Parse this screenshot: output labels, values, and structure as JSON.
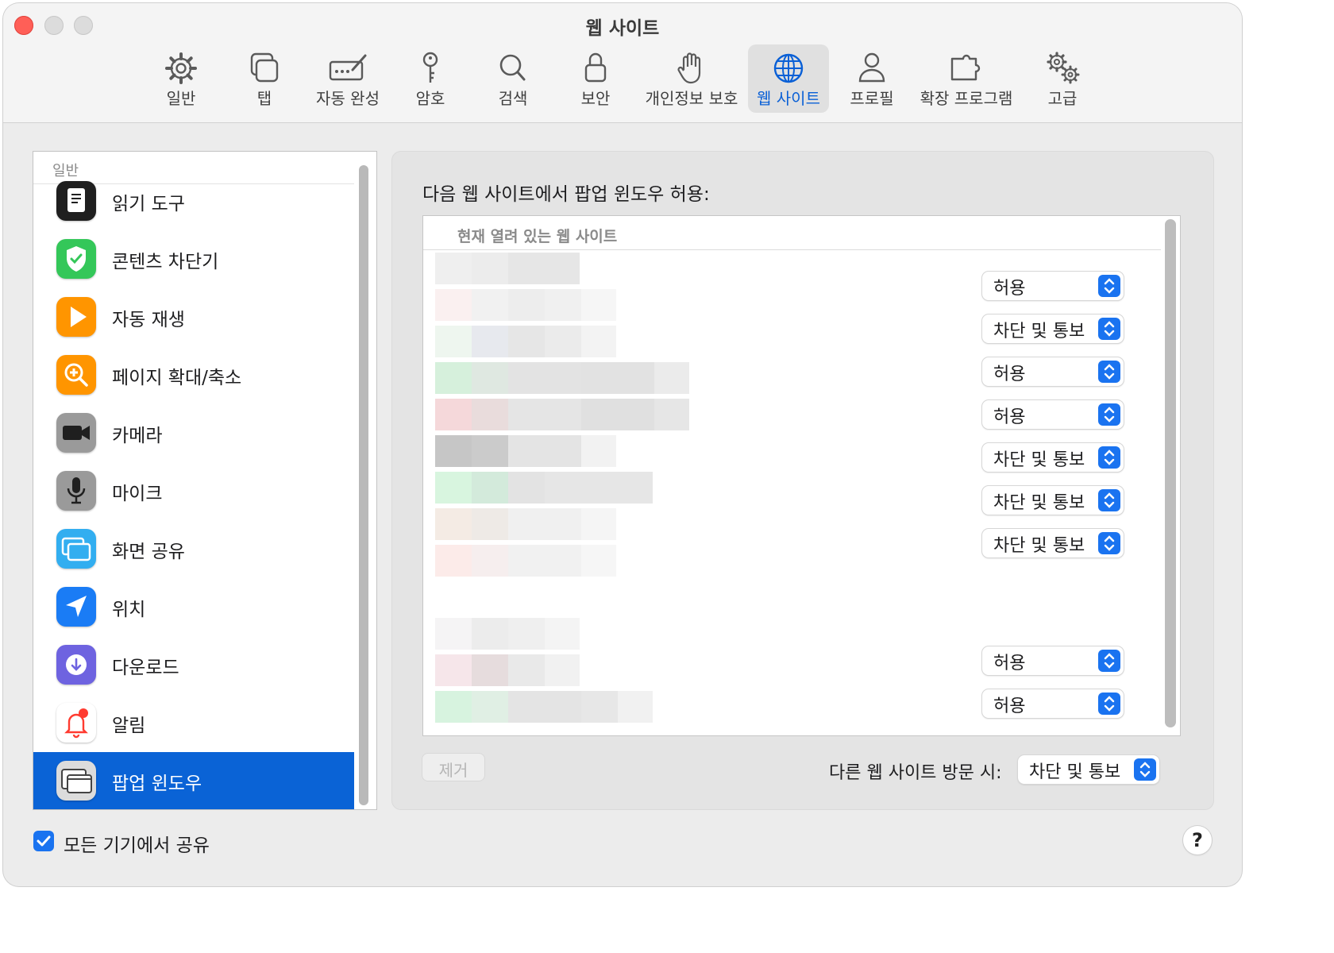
{
  "window": {
    "title": "웹 사이트"
  },
  "toolbar": {
    "items": [
      {
        "label": "일반",
        "icon": "gear-icon"
      },
      {
        "label": "탭",
        "icon": "tabs-icon"
      },
      {
        "label": "자동 완성",
        "icon": "autofill-icon"
      },
      {
        "label": "암호",
        "icon": "key-icon"
      },
      {
        "label": "검색",
        "icon": "search-icon"
      },
      {
        "label": "보안",
        "icon": "lock-icon"
      },
      {
        "label": "개인정보 보호",
        "icon": "hand-icon"
      },
      {
        "label": "웹 사이트",
        "icon": "globe-icon",
        "selected": true
      },
      {
        "label": "프로필",
        "icon": "person-icon"
      },
      {
        "label": "확장 프로그램",
        "icon": "puzzle-icon"
      },
      {
        "label": "고급",
        "icon": "gears-icon"
      }
    ]
  },
  "sidebar": {
    "section_header": "일반",
    "items": [
      {
        "label": "읽기 도구",
        "icon": "reader-icon"
      },
      {
        "label": "콘텐츠 차단기",
        "icon": "shield-check-icon"
      },
      {
        "label": "자동 재생",
        "icon": "play-icon"
      },
      {
        "label": "페이지 확대/축소",
        "icon": "zoom-icon"
      },
      {
        "label": "카메라",
        "icon": "camera-icon"
      },
      {
        "label": "마이크",
        "icon": "microphone-icon"
      },
      {
        "label": "화면 공유",
        "icon": "screen-share-icon"
      },
      {
        "label": "위치",
        "icon": "location-icon"
      },
      {
        "label": "다운로드",
        "icon": "download-icon"
      },
      {
        "label": "알림",
        "icon": "bell-icon"
      },
      {
        "label": "팝업 윈도우",
        "icon": "popup-window-icon",
        "selected": true
      }
    ]
  },
  "main": {
    "title": "다음 웹 사이트에서 팝업 윈도우 허용:",
    "table_header": "현재 열려 있는 웹 사이트",
    "rows": [
      {
        "setting": "허용"
      },
      {
        "setting": "차단 및 통보"
      },
      {
        "setting": "허용"
      },
      {
        "setting": "허용"
      },
      {
        "setting": "차단 및 통보"
      },
      {
        "setting": "차단 및 통보"
      },
      {
        "setting": "차단 및 통보"
      },
      {
        "setting": "허용"
      },
      {
        "setting": "허용"
      }
    ],
    "remove_label": "제거",
    "other_sites_label": "다른 웹 사이트 방문 시:",
    "other_sites_value": "차단 및 통보"
  },
  "footer": {
    "share_label": "모든 기기에서 공유",
    "share_checked": true,
    "help_label": "?"
  },
  "colors": {
    "accent": "#0a63d6",
    "stepper": "#1a73f0",
    "close": "#ff5f57"
  }
}
